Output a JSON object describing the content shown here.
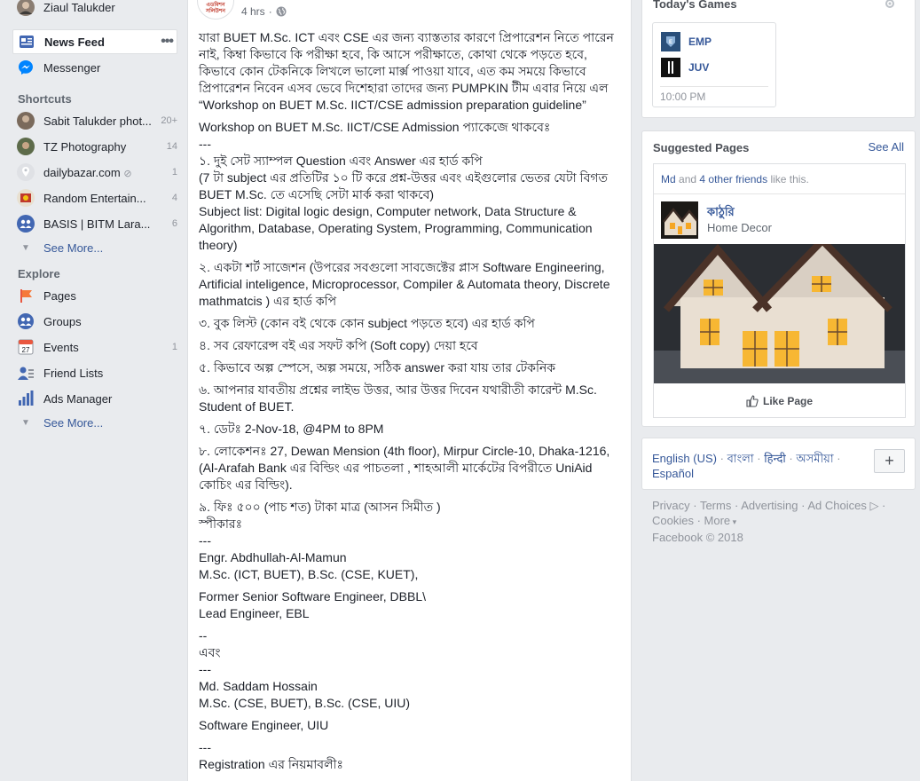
{
  "leftnav": {
    "profile": {
      "name": "Ziaul Talukder"
    },
    "news_feed": {
      "label": "News Feed",
      "more": "•••"
    },
    "messenger": {
      "label": "Messenger"
    },
    "shortcuts_title": "Shortcuts",
    "shortcuts": [
      {
        "label": "Sabit Talukder phot...",
        "count": "20+"
      },
      {
        "label": "TZ Photography",
        "count": "14"
      },
      {
        "label": "dailybazar.com",
        "count": "1"
      },
      {
        "label": "Random Entertain...",
        "count": "4"
      },
      {
        "label": "BASIS | BITM Lara...",
        "count": "6"
      }
    ],
    "see_more_1": "See More...",
    "explore_title": "Explore",
    "explore": [
      {
        "label": "Pages",
        "count": ""
      },
      {
        "label": "Groups",
        "count": ""
      },
      {
        "label": "Events",
        "count": "1",
        "icon_text": "27"
      },
      {
        "label": "Friend Lists",
        "count": ""
      },
      {
        "label": "Ads Manager",
        "count": ""
      }
    ],
    "see_more_2": "See More..."
  },
  "post": {
    "avatar_text": "PUMPKIN এডমিশন সলিউশন",
    "time": "4 hrs",
    "dot": "·",
    "lines": [
      "যারা BUET M.Sc. ICT এবং CSE এর জন্য ব্যাস্ততার কারণে প্রিপারেশন নিতে পারেন নাই, কিম্বা কিভাবে কি পরীক্ষা হবে, কি আসে পরীক্ষাতে, কোথা থেকে পড়তে হবে, কিভাবে কোন টেকনিকে লিখলে ভালো মার্ক্স পাওয়া যাবে, এত কম সময়ে কিভাবে প্রিপারেশন নিবেন এসব ভেবে দিশেহারা তাদের জন্য PUMPKIN টীম এবার নিয়ে এল “Workshop on BUET M.Sc. IICT/CSE admission preparation guideline”",
      "Workshop on BUET M.Sc. IICT/CSE Admission প্যাকেজে থাকবেঃ",
      "---",
      "১. দুই সেট স্যাম্পল Question এবং Answer এর হার্ড কপি",
      "(7 টা subject এর প্রতিটির ১০ টি করে প্রশ্ন-উত্তর এবং এইগুলোর ভেতর যেটা বিগত BUET M.Sc. তে এসেছি সেটা মার্ক করা থাকবে)",
      "Subject list: Digital logic design, Computer network, Data Structure & Algorithm, Database, Operating System, Programming, Communication theory)",
      "২. একটা শর্ট সাজেশন (উপরের সবগুলো সাবজেক্টের প্লাস Software Engineering, Artificial inteligence, Microprocessor, Compiler & Automata theory, Discrete mathmatcis ) এর হার্ড কপি",
      "৩. বুক লিস্ট (কোন বই থেকে কোন subject পড়তে হবে) এর হার্ড কপি",
      "৪. সব রেফারেন্স বই এর সফট কপি (Soft copy) দেয়া হবে",
      "৫. কিভাবে অল্প স্পেসে, অল্প সময়ে, সঠিক answer করা যায় তার টেকনিক",
      "৬. আপনার যাবতীয় প্রশ্নের লাইভ উত্তর, আর উত্তর দিবেন যথারীতী কারেন্ট M.Sc. Student of BUET.",
      "৭. ডেটঃ 2-Nov-18, @4PM to 8PM",
      "৮. লোকেশনঃ 27, Dewan Mension (4th floor), Mirpur Circle-10, Dhaka-1216, (Al-Arafah Bank এর বিল্ডিং এর পাচতলা , শাহআলী মার্কেটের বিপরীতে UniAid কোচিং এর বিল্ডিং).",
      "৯. ফিঃ ৫০০ (পাচ শত) টাকা মাত্র (আসন সিমীত )",
      "স্পীকারঃ",
      "---",
      "Engr. Abdhullah-Al-Mamun",
      "M.Sc. (ICT, BUET), B.Sc. (CSE, KUET),",
      "Former Senior Software Engineer, DBBL\\",
      "Lead Engineer, EBL",
      "--",
      "এবং",
      "---",
      "Md. Saddam Hossain",
      "M.Sc. (CSE, BUET), B.Sc. (CSE, UIU)",
      "Software Engineer, UIU",
      "---",
      "Registration এর নিয়মাবলীঃ"
    ]
  },
  "games": {
    "title": "Today's Games",
    "items": [
      {
        "name": "EMP",
        "color": "#2a4f7a"
      },
      {
        "name": "JUV",
        "color": "#111111"
      }
    ],
    "time": "10:00 PM"
  },
  "suggested": {
    "title": "Suggested Pages",
    "see_all": "See All",
    "friend_name": "Md",
    "and_text": "and",
    "others_text": "4 other friends",
    "like_text": "like this.",
    "page_name": "কাঠুরি",
    "page_category": "Home Decor",
    "like_button": "Like Page"
  },
  "languages": {
    "items": [
      "English (US)",
      "বাংলা",
      "हिन्दी",
      "অসমীয়া",
      "Español"
    ],
    "sep": "·",
    "plus": "+"
  },
  "footer": {
    "links": [
      "Privacy",
      "Terms",
      "Advertising",
      "Ad Choices",
      "Cookies",
      "More"
    ],
    "copyright": "Facebook © 2018"
  },
  "colors": {
    "link": "#365899",
    "muted": "#90949c",
    "background": "#e9ebee"
  }
}
